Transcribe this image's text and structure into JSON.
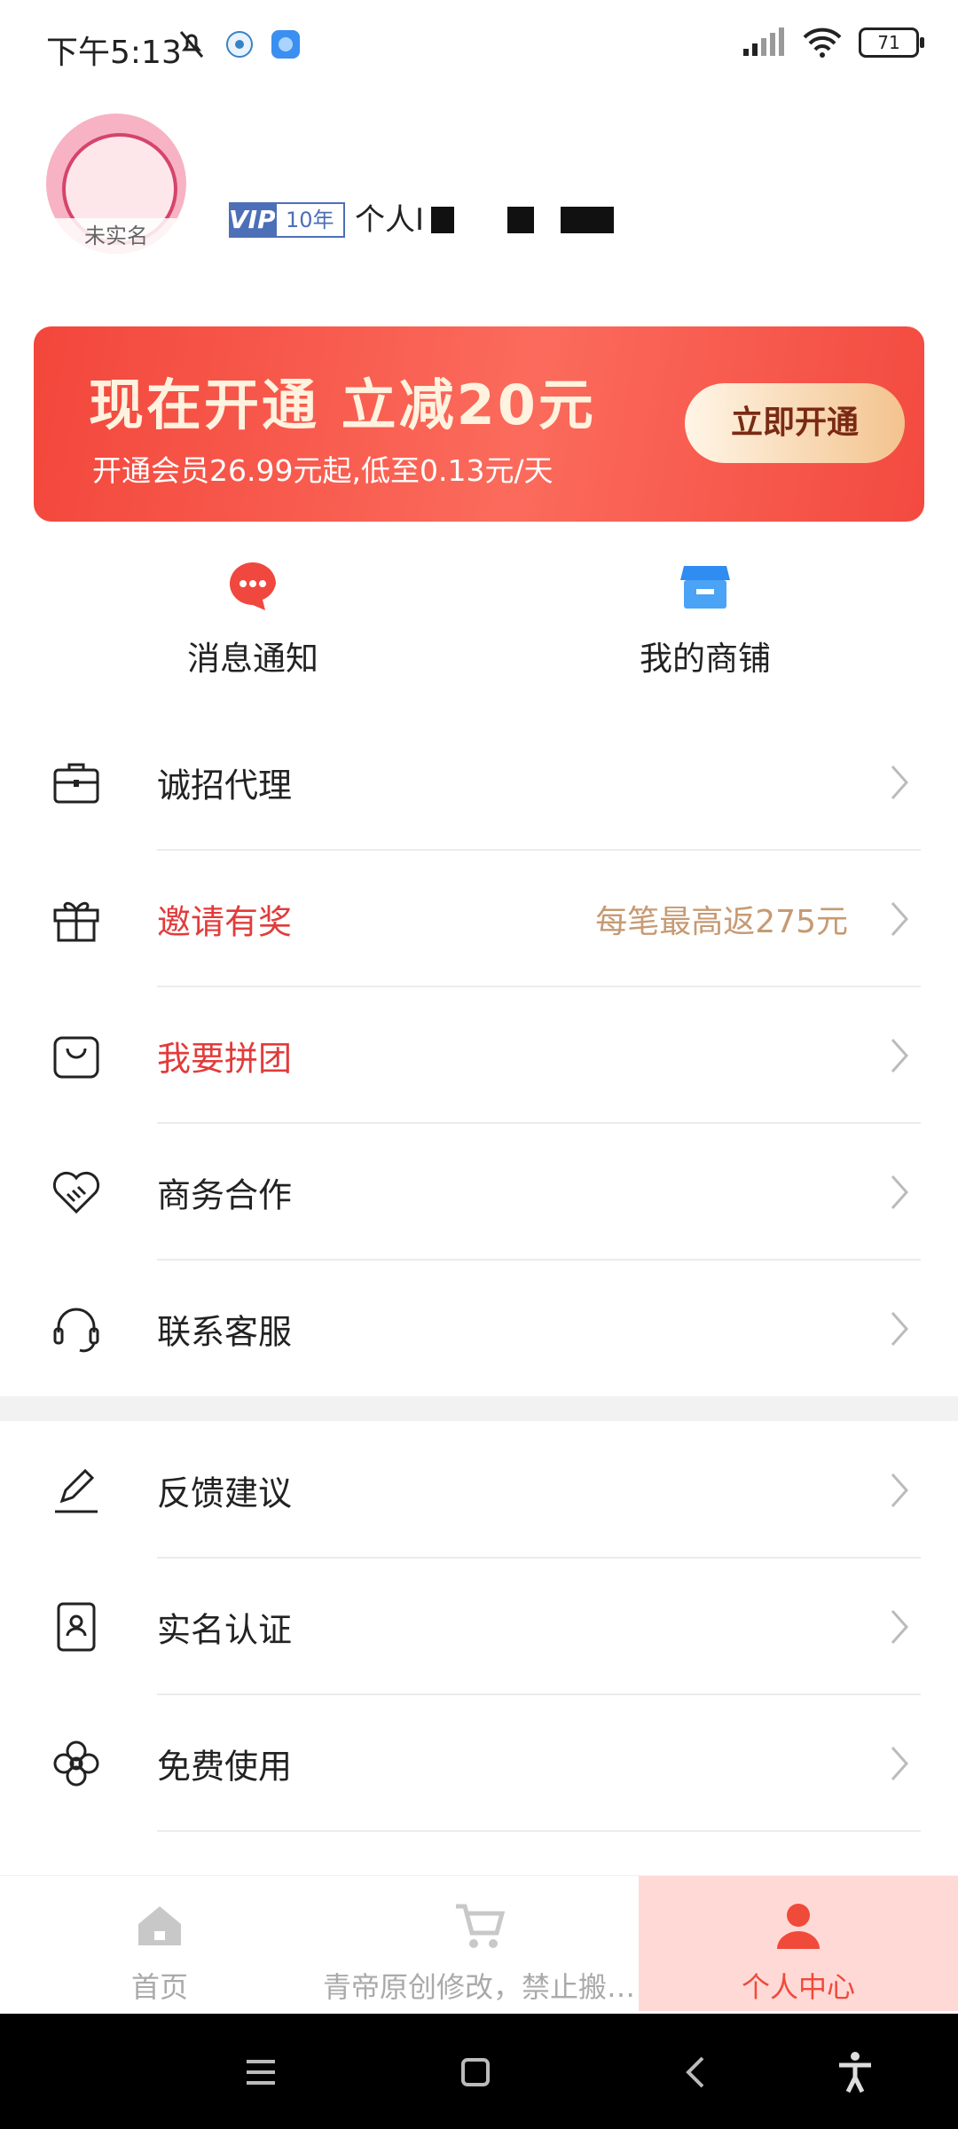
{
  "status_bar": {
    "time": "下午5:13",
    "battery": "71"
  },
  "profile": {
    "avatar_tag": "未实名",
    "vip_badge": "VIP",
    "vip_years": "10年",
    "id_label": "个人I"
  },
  "banner": {
    "title": "现在开通 立减20元",
    "subtitle": "开通会员26.99元起,低至0.13元/天",
    "button": "立即开通"
  },
  "quick_entries": [
    {
      "label": "消息通知",
      "icon": "message-bubble-icon",
      "color": "#f0483e"
    },
    {
      "label": "我的商铺",
      "icon": "shop-icon",
      "color": "#2f8cf0"
    }
  ],
  "menu_group_1": [
    {
      "label": "诚招代理",
      "icon": "briefcase-icon"
    },
    {
      "label": "邀请有奖",
      "icon": "gift-icon",
      "highlight": true,
      "extra": "每笔最高返275元"
    },
    {
      "label": "我要拼团",
      "icon": "shopping-bag-icon",
      "highlight": true
    },
    {
      "label": "商务合作",
      "icon": "handshake-heart-icon"
    },
    {
      "label": "联系客服",
      "icon": "headset-icon"
    }
  ],
  "menu_group_2": [
    {
      "label": "反馈建议",
      "icon": "edit-pen-icon"
    },
    {
      "label": "实名认证",
      "icon": "id-card-icon"
    },
    {
      "label": "免费使用",
      "icon": "flower-icon"
    }
  ],
  "tabbar": [
    {
      "label": "首页",
      "icon": "home-icon"
    },
    {
      "label": "青帝原创修改，禁止搬…",
      "icon": "cart-icon"
    },
    {
      "label": "个人中心",
      "icon": "person-icon",
      "active": true
    }
  ],
  "colors": {
    "accent": "#f04a3a",
    "highlight_text": "#e23b3b",
    "reward_text": "#c69a73"
  }
}
